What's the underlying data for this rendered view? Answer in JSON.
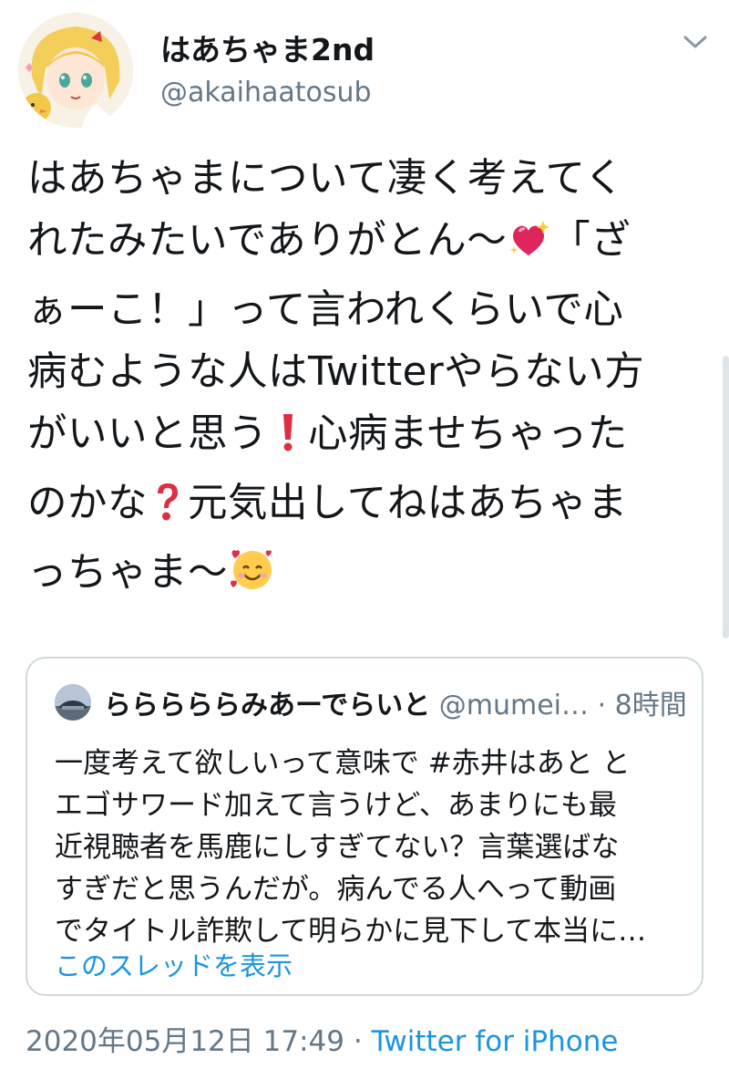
{
  "tweet": {
    "author": {
      "display_name": "はあちゃま2nd",
      "handle": "@akaihaatosub"
    },
    "text_lines": [
      "はあちゃまについて凄く考えてく",
      "れたみたいでありがとん〜",
      "「ざ",
      "ぁーこ！」って言われくらいで心",
      "病むような人はTwitterやらない方",
      "がいいと思う",
      "心病ませちゃった",
      "のかな",
      "元気出してねはあちゃま",
      "っちゃま〜"
    ],
    "emoji": {
      "sparkling_heart": "sparkling-heart-icon",
      "exclamation": "red-exclamation-icon",
      "question": "red-question-icon",
      "smiling_hearts": "smiling-face-with-hearts-icon"
    },
    "timestamp": "2020年05月12日 17:49",
    "separator": "·",
    "source": "Twitter for iPhone"
  },
  "quote": {
    "display_name": "らららららみあーでらいと",
    "handle": "@mumei…",
    "separator": "·",
    "time": "8時間",
    "text_lines": [
      "一度考えて欲しいって意味で #赤井はあと と",
      "エゴサワード加えて言うけど、あまりにも最",
      "近視聴者を馬鹿にしすぎてない？言葉選ばな",
      "すぎだと思うんだが。病んでる人へって動画",
      "でタイトル詐欺して明らかに見下して本当に…"
    ],
    "thread_link": "このスレッドを表示"
  },
  "colors": {
    "text": "#14171a",
    "secondary": "#657786",
    "link": "#1b95e0",
    "border": "#cfd9de"
  }
}
